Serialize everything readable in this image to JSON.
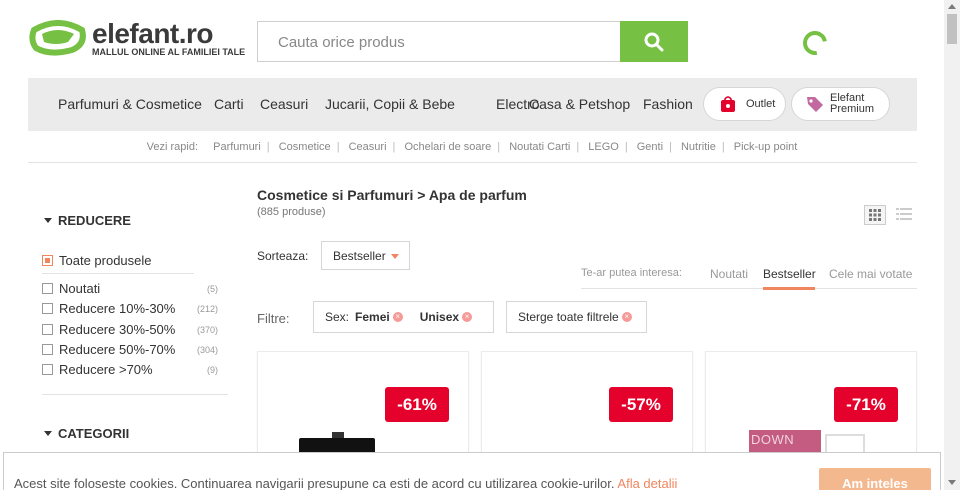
{
  "brand": {
    "name": "elefant.ro",
    "tagline": "MALLUL ONLINE AL FAMILIEI TALE",
    "green": "#76c043",
    "accent": "#f0855e",
    "badge_red": "#e4012c"
  },
  "search": {
    "placeholder": "Cauta orice produs",
    "button_icon": "search-icon"
  },
  "nav": {
    "items": [
      "Parfumuri & Cosmetice",
      "Carti",
      "Ceasuri",
      "Jucarii, Copii & Bebe",
      "Electro",
      "Casa & Petshop",
      "Fashion"
    ],
    "outlet": "Outlet",
    "premium_line1": "Elefant",
    "premium_line2": "Premium"
  },
  "quick": {
    "label": "Vezi rapid:",
    "links": [
      "Parfumuri",
      "Cosmetice",
      "Ceasuri",
      "Ochelari de soare",
      "Noutati Carti",
      "LEGO",
      "Genti",
      "Nutritie",
      "Pick-up point"
    ]
  },
  "sidebar": {
    "reducere_title": "REDUCERE",
    "all_products": "Toate produsele",
    "filters": [
      {
        "label": "Noutati",
        "count": "(5)"
      },
      {
        "label": "Reducere 10%-30%",
        "count": "(212)"
      },
      {
        "label": "Reducere 30%-50%",
        "count": "(370)"
      },
      {
        "label": "Reducere 50%-70%",
        "count": "(304)"
      },
      {
        "label": "Reducere >70%",
        "count": "(9)"
      }
    ],
    "categorii_title": "CATEGORII"
  },
  "main": {
    "breadcrumb": "Cosmetice si Parfumuri > Apa de parfum",
    "count": "(885 produse)",
    "sort_label": "Sorteaza:",
    "sort_value": "Bestseller",
    "interest_label": "Te-ar putea interesa:",
    "tabs": [
      "Noutati",
      "Bestseller",
      "Cele mai votate"
    ],
    "active_tab": "Bestseller",
    "filters_label": "Filtre:",
    "sex_label": "Sex:",
    "sex_values": [
      "Femei",
      "Unisex"
    ],
    "clear_filters": "Sterge toate filtrele"
  },
  "products": [
    {
      "discount": "-61%"
    },
    {
      "discount": "-57%"
    },
    {
      "discount": "-71%",
      "image_text": "DOWN"
    }
  ],
  "cookie": {
    "text": "Acest site foloseste cookies. Continuarea navigarii presupune ca esti de acord cu utilizarea cookie-urilor.",
    "link": "Afla detalii",
    "button": "Am inteles"
  }
}
